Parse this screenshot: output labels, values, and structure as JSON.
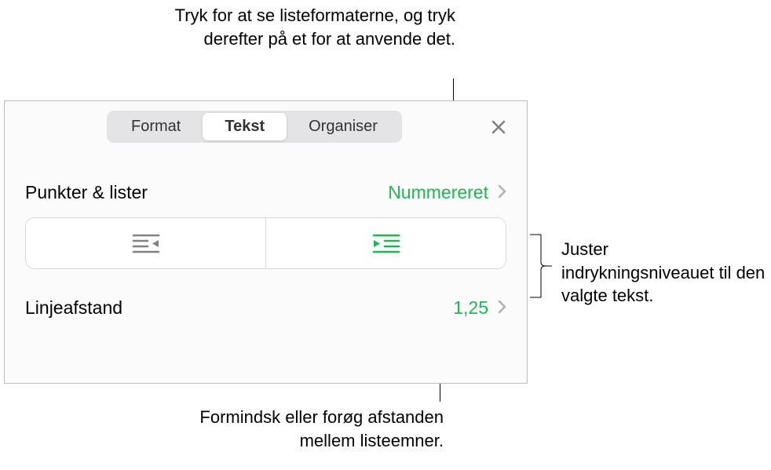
{
  "annotations": {
    "top": "Tryk for at se listeformaterne, og tryk derefter på et for at anvende det.",
    "right": "Juster indrykningsniveauet til den valgte tekst.",
    "bottom": "Formindsk eller forøg afstanden mellem listeemner."
  },
  "tabs": {
    "format": "Format",
    "text": "Tekst",
    "organize": "Organiser"
  },
  "rows": {
    "bullets_label": "Punkter & lister",
    "bullets_value": "Nummereret",
    "spacing_label": "Linjeafstand",
    "spacing_value": "1,25"
  },
  "colors": {
    "accent": "#1db653",
    "icon_gray": "#808086"
  }
}
